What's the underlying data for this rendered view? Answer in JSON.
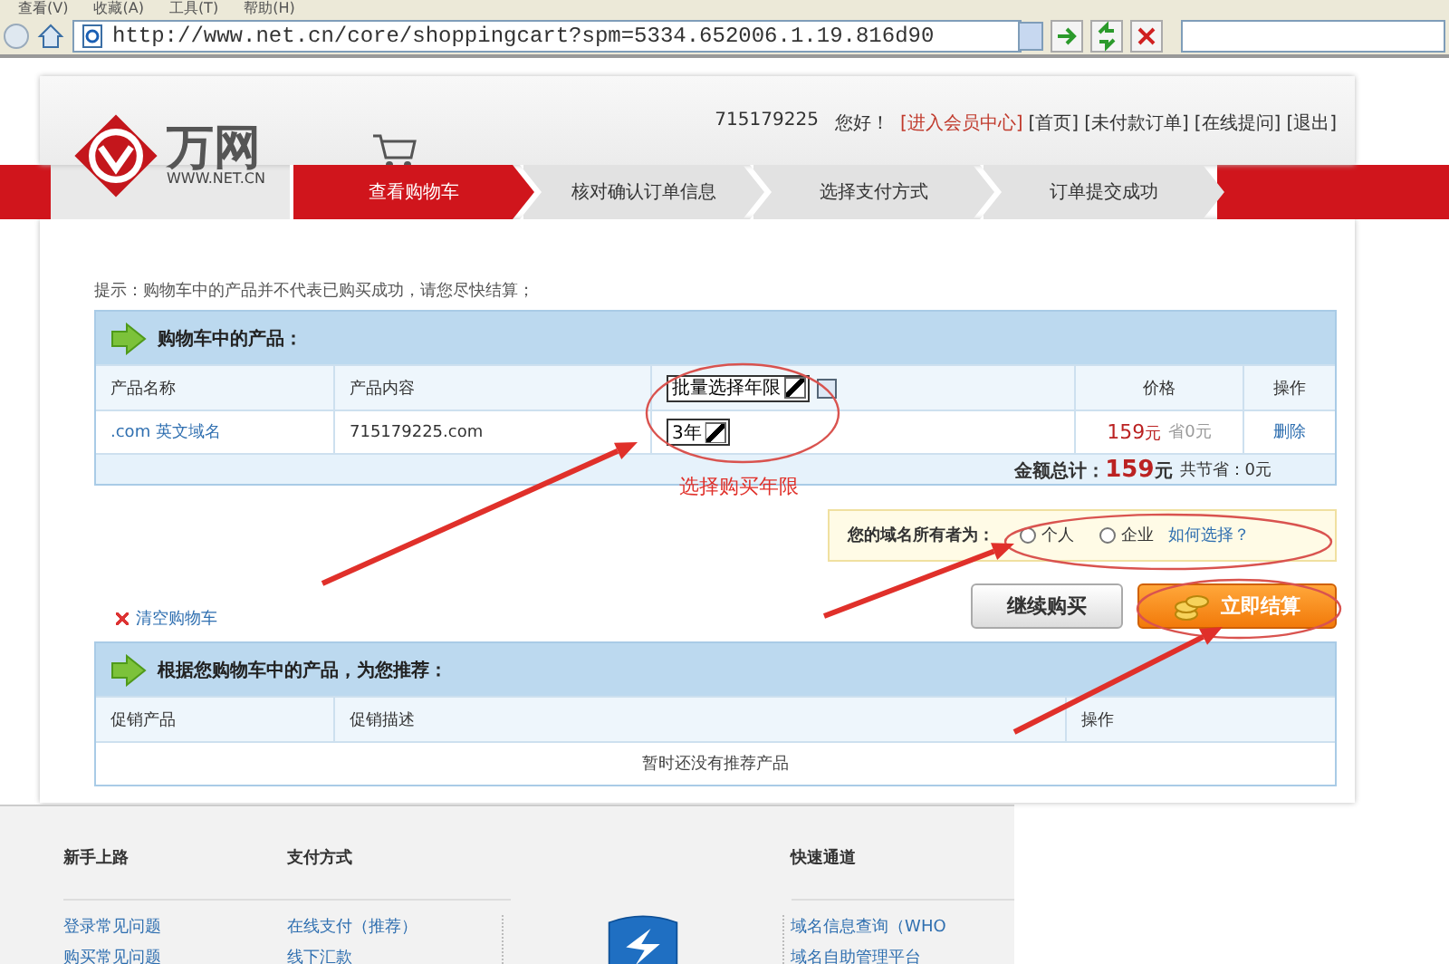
{
  "browser": {
    "menu": [
      "查看(V)",
      "收藏(A)",
      "工具(T)",
      "帮助(H)"
    ],
    "address": "http://www.net.cn/core/shoppingcart?spm=5334.652006.1.19.816d90"
  },
  "header": {
    "logo_text": "万网",
    "logo_sub": "WWW.NET.CN",
    "user": "715179225",
    "greeting": "您好！",
    "links": [
      {
        "label": "[进入会员中心]",
        "kind": "highlight"
      },
      {
        "label": "[首页]",
        "kind": "plain"
      },
      {
        "label": "[未付款订单]",
        "kind": "plain"
      },
      {
        "label": "[在线提问]",
        "kind": "plain"
      },
      {
        "label": "[退出]",
        "kind": "plain"
      }
    ]
  },
  "steps": [
    {
      "label": "查看购物车",
      "selected": true
    },
    {
      "label": "核对确认订单信息",
      "selected": false
    },
    {
      "label": "选择支付方式",
      "selected": false
    },
    {
      "label": "订单提交成功",
      "selected": false
    }
  ],
  "tip": "提示：购物车中的产品并不代表已购买成功，请您尽快结算；",
  "cart": {
    "title": "购物车中的产品：",
    "columns": [
      "产品名称",
      "产品内容",
      "批量选择年限",
      "价格",
      "操作"
    ],
    "rows": [
      {
        "name": ".com 英文域名",
        "content": "715179225.com",
        "term": "3年",
        "price": "159",
        "price_unit": "元",
        "saved": "省0元",
        "action": "删除"
      }
    ],
    "total_label": "金额总计：",
    "total": "159",
    "total_unit": "元",
    "saved_label": "共节省：0元"
  },
  "owner": {
    "label": "您的域名所有者为：",
    "options": [
      {
        "label": "个人",
        "selected": false
      },
      {
        "label": "企业",
        "selected": false
      }
    ],
    "help": "如何选择？"
  },
  "clear": "清空购物车",
  "buttons": [
    {
      "kind": "secondary",
      "label": "继续购买"
    },
    {
      "kind": "primary",
      "label": "立即结算"
    }
  ],
  "recommend": {
    "title": "根据您购物车中的产品，为您推荐：",
    "columns": [
      "促销产品",
      "促销描述",
      "操作"
    ],
    "empty": "暂时还没有推荐产品"
  },
  "footer": {
    "columns": [
      {
        "title": "新手上路",
        "links": [
          "登录常见问题",
          "购买常见问题"
        ]
      },
      {
        "title": "支付方式",
        "links": [
          "在线支付（推荐）",
          "线下汇款"
        ]
      },
      {
        "title": "快速通道",
        "links": [
          "域名信息查询（WHO",
          "域名自助管理平台"
        ]
      }
    ]
  },
  "annotation": "选择购买年限"
}
